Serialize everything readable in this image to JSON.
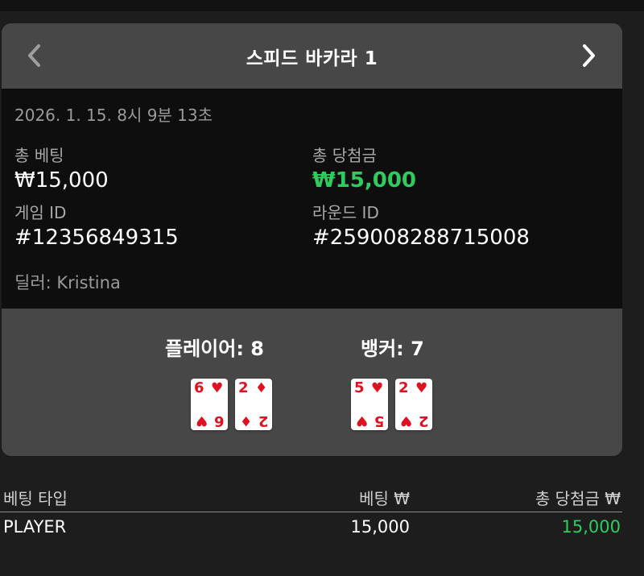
{
  "header": {
    "title": "스피드 바카라 1",
    "prev_icon": "chevron-left-icon",
    "next_icon": "chevron-right-icon"
  },
  "info": {
    "date": "2026. 1. 15. 8시 9분 13초",
    "total_bet_label": "총 베팅",
    "total_bet_value": "₩15,000",
    "total_win_label": "총 당첨금",
    "total_win_value": "₩15,000",
    "game_id_label": "게임 ID",
    "game_id_value": "#12356849315",
    "round_id_label": "라운드 ID",
    "round_id_value": "#259008288715008",
    "dealer": "딜러: Kristina"
  },
  "result": {
    "player_label": "플레이어: 8",
    "banker_label": "뱅커: 7",
    "player_cards": [
      {
        "rank": "6",
        "suit": "♥"
      },
      {
        "rank": "2",
        "suit": "♦"
      }
    ],
    "banker_cards": [
      {
        "rank": "5",
        "suit": "♥"
      },
      {
        "rank": "2",
        "suit": "♥"
      }
    ]
  },
  "table": {
    "headers": [
      "베팅 타입",
      "베팅 ₩",
      "총 당첨금 ₩"
    ],
    "rows": [
      {
        "type": "PLAYER",
        "bet": "15,000",
        "win": "15,000"
      }
    ]
  },
  "colors": {
    "win_green": "#2ecc5f",
    "card_red": "#e01020",
    "panel_gray": "#474747",
    "info_black": "#0e0e0e"
  }
}
